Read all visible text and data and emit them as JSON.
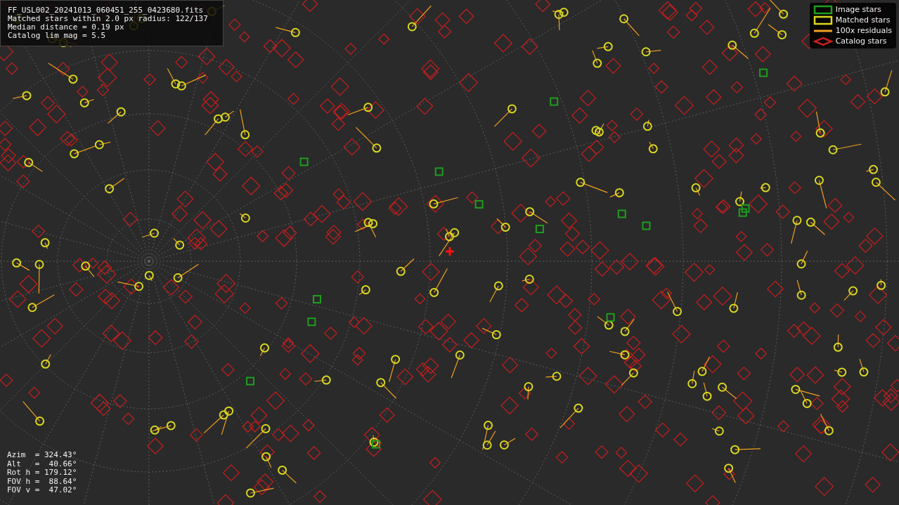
{
  "info_panel": {
    "lines": [
      "FF_USL002_20241013_060451_255_0423680.fits",
      "Matched stars within 2.0 px radius: 122/137",
      "Median distance = 0.19 px",
      "Catalog lim mag = 5.5"
    ]
  },
  "legend": [
    {
      "kind": "rect",
      "color": "#1e9e1e",
      "label": "Image stars"
    },
    {
      "kind": "rect",
      "color": "#d8d820",
      "label": "Matched stars"
    },
    {
      "kind": "line",
      "color": "#f0a020",
      "label": "100x residuals"
    },
    {
      "kind": "diamond",
      "color": "#c81e1e",
      "label": "Catalog stars"
    }
  ],
  "pointing": {
    "lines": [
      "Azim  = 324.43°",
      "Alt   =  40.66°",
      "Rot h = 179.12°",
      "FOV h =  88.64°",
      "FOV v =  47.02°"
    ]
  }
}
